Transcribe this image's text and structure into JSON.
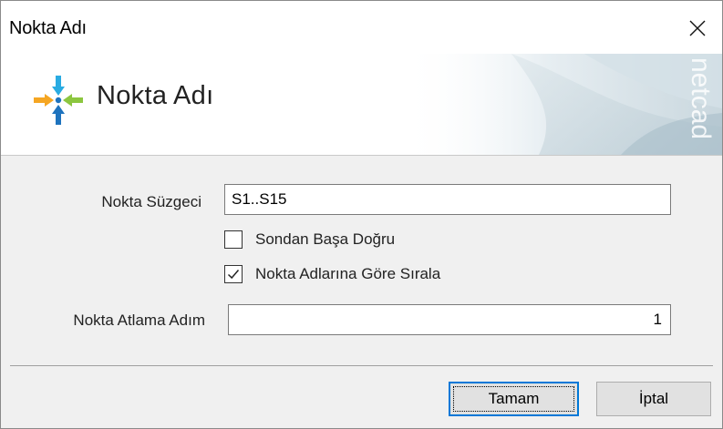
{
  "window": {
    "title": "Nokta Adı"
  },
  "banner": {
    "title": "Nokta Adı",
    "watermark": "netcad"
  },
  "form": {
    "filter_label": "Nokta Süzgeci",
    "filter_value": "S1..S15",
    "reverse_label": "Sondan Başa Doğru",
    "reverse_checked": false,
    "sort_label": "Nokta Adlarına Göre Sırala",
    "sort_checked": true,
    "step_label": "Nokta Atlama Adım",
    "step_value": "1"
  },
  "buttons": {
    "ok_label": "Tamam",
    "cancel_label": "İptal"
  },
  "colors": {
    "accent": "#0078d7",
    "logo_orange": "#f5a623",
    "logo_green": "#8cc63f",
    "logo_blue": "#1e73be",
    "logo_cyan": "#29abe2"
  }
}
